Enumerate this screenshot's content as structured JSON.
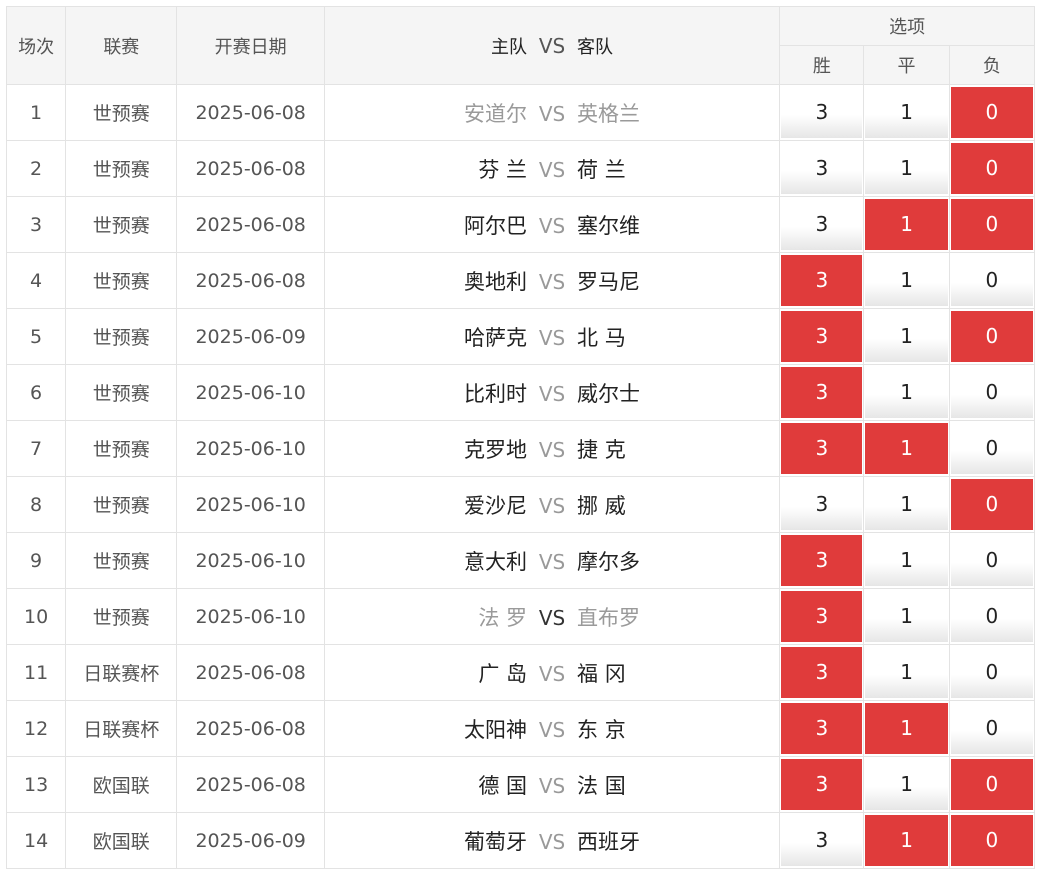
{
  "headers": {
    "index": "场次",
    "league": "联赛",
    "date": "开赛日期",
    "home": "主队",
    "vs": "VS",
    "away": "客队",
    "options": "选项",
    "win": "胜",
    "draw": "平",
    "loss": "负"
  },
  "colors": {
    "selected": "#e03b3b",
    "unselected": "#f0f0f0"
  },
  "rows": [
    {
      "index": "1",
      "league": "世预赛",
      "date": "2025-06-08",
      "home": "安道尔",
      "vs": "VS",
      "away": "英格兰",
      "win": "3",
      "draw": "1",
      "loss": "0",
      "sel": {
        "win": false,
        "draw": false,
        "loss": true
      },
      "style": "muted"
    },
    {
      "index": "2",
      "league": "世预赛",
      "date": "2025-06-08",
      "home": "芬 兰",
      "vs": "VS",
      "away": "荷 兰",
      "win": "3",
      "draw": "1",
      "loss": "0",
      "sel": {
        "win": false,
        "draw": false,
        "loss": true
      },
      "style": ""
    },
    {
      "index": "3",
      "league": "世预赛",
      "date": "2025-06-08",
      "home": "阿尔巴",
      "vs": "VS",
      "away": "塞尔维",
      "win": "3",
      "draw": "1",
      "loss": "0",
      "sel": {
        "win": false,
        "draw": true,
        "loss": true
      },
      "style": ""
    },
    {
      "index": "4",
      "league": "世预赛",
      "date": "2025-06-08",
      "home": "奥地利",
      "vs": "VS",
      "away": "罗马尼",
      "win": "3",
      "draw": "1",
      "loss": "0",
      "sel": {
        "win": true,
        "draw": false,
        "loss": false
      },
      "style": ""
    },
    {
      "index": "5",
      "league": "世预赛",
      "date": "2025-06-09",
      "home": "哈萨克",
      "vs": "VS",
      "away": "北 马",
      "win": "3",
      "draw": "1",
      "loss": "0",
      "sel": {
        "win": true,
        "draw": false,
        "loss": true
      },
      "style": ""
    },
    {
      "index": "6",
      "league": "世预赛",
      "date": "2025-06-10",
      "home": "比利时",
      "vs": "VS",
      "away": "威尔士",
      "win": "3",
      "draw": "1",
      "loss": "0",
      "sel": {
        "win": true,
        "draw": false,
        "loss": false
      },
      "style": ""
    },
    {
      "index": "7",
      "league": "世预赛",
      "date": "2025-06-10",
      "home": "克罗地",
      "vs": "VS",
      "away": "捷 克",
      "win": "3",
      "draw": "1",
      "loss": "0",
      "sel": {
        "win": true,
        "draw": true,
        "loss": false
      },
      "style": ""
    },
    {
      "index": "8",
      "league": "世预赛",
      "date": "2025-06-10",
      "home": "爱沙尼",
      "vs": "VS",
      "away": "挪 威",
      "win": "3",
      "draw": "1",
      "loss": "0",
      "sel": {
        "win": false,
        "draw": false,
        "loss": true
      },
      "style": ""
    },
    {
      "index": "9",
      "league": "世预赛",
      "date": "2025-06-10",
      "home": "意大利",
      "vs": "VS",
      "away": "摩尔多",
      "win": "3",
      "draw": "1",
      "loss": "0",
      "sel": {
        "win": true,
        "draw": false,
        "loss": false
      },
      "style": ""
    },
    {
      "index": "10",
      "league": "世预赛",
      "date": "2025-06-10",
      "home": "法 罗",
      "vs": "VS",
      "away": "直布罗",
      "win": "3",
      "draw": "1",
      "loss": "0",
      "sel": {
        "win": true,
        "draw": false,
        "loss": false
      },
      "style": "muted dark"
    },
    {
      "index": "11",
      "league": "日联赛杯",
      "date": "2025-06-08",
      "home": "广 岛",
      "vs": "VS",
      "away": "福 冈",
      "win": "3",
      "draw": "1",
      "loss": "0",
      "sel": {
        "win": true,
        "draw": false,
        "loss": false
      },
      "style": ""
    },
    {
      "index": "12",
      "league": "日联赛杯",
      "date": "2025-06-08",
      "home": "太阳神",
      "vs": "VS",
      "away": "东 京",
      "win": "3",
      "draw": "1",
      "loss": "0",
      "sel": {
        "win": true,
        "draw": true,
        "loss": false
      },
      "style": ""
    },
    {
      "index": "13",
      "league": "欧国联",
      "date": "2025-06-08",
      "home": "德 国",
      "vs": "VS",
      "away": "法 国",
      "win": "3",
      "draw": "1",
      "loss": "0",
      "sel": {
        "win": true,
        "draw": false,
        "loss": true
      },
      "style": ""
    },
    {
      "index": "14",
      "league": "欧国联",
      "date": "2025-06-09",
      "home": "葡萄牙",
      "vs": "VS",
      "away": "西班牙",
      "win": "3",
      "draw": "1",
      "loss": "0",
      "sel": {
        "win": false,
        "draw": true,
        "loss": true
      },
      "style": ""
    }
  ]
}
